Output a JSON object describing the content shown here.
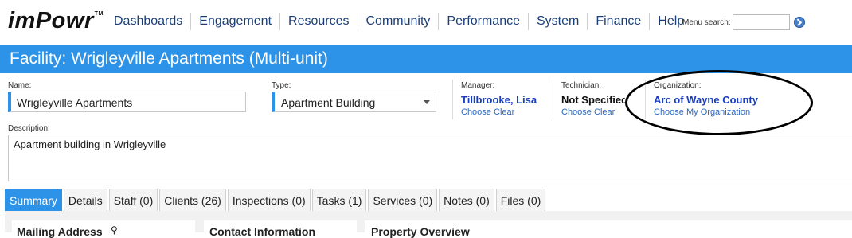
{
  "logo": {
    "text": "imPowr",
    "tm": "TM"
  },
  "nav": [
    "Dashboards",
    "Engagement",
    "Resources",
    "Community",
    "Performance",
    "System",
    "Finance",
    "Help"
  ],
  "menu_search": {
    "label": "Menu search:",
    "value": ""
  },
  "title": "Facility: Wrigleyville Apartments (Multi-unit)",
  "name": {
    "label": "Name:",
    "value": "Wrigleyville Apartments"
  },
  "type": {
    "label": "Type:",
    "value": "Apartment Building"
  },
  "manager": {
    "label": "Manager:",
    "name": "Tillbrooke, Lisa",
    "choose": "Choose",
    "clear": "Clear"
  },
  "technician": {
    "label": "Technician:",
    "name": "Not Specified",
    "choose": "Choose",
    "clear": "Clear"
  },
  "organization": {
    "label": "Organization:",
    "name": "Arc of Wayne County",
    "choose": "Choose",
    "my_org": "My Organization"
  },
  "description": {
    "label": "Description:",
    "value": "Apartment building in Wrigleyville"
  },
  "tabs": [
    "Summary",
    "Details",
    "Staff (0)",
    "Clients (26)",
    "Inspections (0)",
    "Tasks (1)",
    "Services (0)",
    "Notes (0)",
    "Files (0)"
  ],
  "sections": {
    "mailing": "Mailing Address",
    "contact": "Contact Information",
    "property": "Property Overview"
  },
  "colors": {
    "accent": "#2d93e8",
    "link": "#2a68c2",
    "nav": "#1a3e78",
    "person": "#1a3ec0"
  }
}
